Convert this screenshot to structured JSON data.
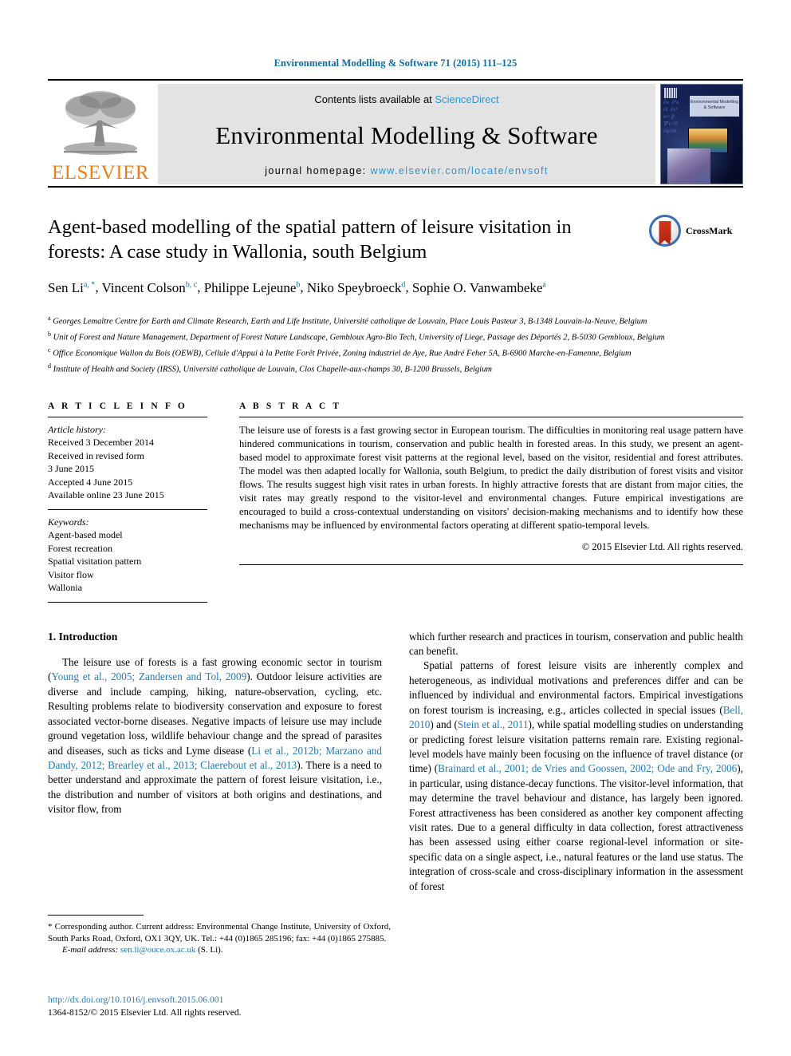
{
  "running_head": "Environmental Modelling & Software 71 (2015) 111–125",
  "masthead": {
    "publisher_logo_text": "ELSEVIER",
    "contents_prefix": "Contents lists available at ",
    "contents_link": "ScienceDirect",
    "journal_title": "Environmental Modelling & Software",
    "homepage_prefix": "journal homepage: ",
    "homepage_url": "www.elsevier.com/locate/envsoft",
    "cover_title": "Environmental Modelling & Software"
  },
  "article": {
    "title": "Agent-based modelling of the spatial pattern of leisure visitation in forests: A case study in Wallonia, south Belgium",
    "authors_line_1": "Sen Li",
    "authors_html": "Sen Li a, *, Vincent Colson b, c, Philippe Lejeune b, Niko Speybroeck d, Sophie O. Vanwambeke a",
    "crossmark_label": "CrossMark"
  },
  "affiliations": [
    {
      "marker": "a",
      "text": "Georges Lemaître Centre for Earth and Climate Research, Earth and Life Institute, Université catholique de Louvain, Place Louis Pasteur 3, B-1348 Louvain-la-Neuve, Belgium"
    },
    {
      "marker": "b",
      "text": "Unit of Forest and Nature Management, Department of Forest Nature Landscape, Gembloux Agro-Bio Tech, University of Liege, Passage des Déportés 2, B-5030 Gembloux, Belgium"
    },
    {
      "marker": "c",
      "text": "Office Economique Wallon du Bois (OEWB), Cellule d'Appui à la Petite Forêt Privée, Zoning industriel de Aye, Rue André Feher 5A, B-6900 Marche-en-Famenne, Belgium"
    },
    {
      "marker": "d",
      "text": "Institute of Health and Society (IRSS), Université catholique de Louvain, Clos Chapelle-aux-champs 30, B-1200 Brussels, Belgium"
    }
  ],
  "article_info": {
    "heading": "A R T I C L E   I N F O",
    "history_label": "Article history:",
    "history": [
      "Received 3 December 2014",
      "Received in revised form",
      "3 June 2015",
      "Accepted 4 June 2015",
      "Available online 23 June 2015"
    ],
    "keywords_label": "Keywords:",
    "keywords": [
      "Agent-based model",
      "Forest recreation",
      "Spatial visitation pattern",
      "Visitor flow",
      "Wallonia"
    ]
  },
  "abstract": {
    "heading": "A B S T R A C T",
    "text": "The leisure use of forests is a fast growing sector in European tourism. The difficulties in monitoring real usage pattern have hindered communications in tourism, conservation and public health in forested areas. In this study, we present an agent-based model to approximate forest visit patterns at the regional level, based on the visitor, residential and forest attributes. The model was then adapted locally for Wallonia, south Belgium, to predict the daily distribution of forest visits and visitor flows. The results suggest high visit rates in urban forests. In highly attractive forests that are distant from major cities, the visit rates may greatly respond to the visitor-level and environmental changes. Future empirical investigations are encouraged to build a cross-contextual understanding on visitors' decision-making mechanisms and to identify how these mechanisms may be influenced by environmental factors operating at different spatio-temporal levels.",
    "copyright": "© 2015 Elsevier Ltd. All rights reserved."
  },
  "introduction": {
    "heading": "1. Introduction",
    "left_paragraph_1_a": "The leisure use of forests is a fast growing economic sector in tourism (",
    "left_cite_1": "Young et al., 2005; Zandersen and Tol, 2009",
    "left_paragraph_1_b": "). Outdoor leisure activities are diverse and include camping, hiking, nature-observation, cycling, etc. Resulting problems relate to biodiversity conservation and exposure to forest associated vector-borne diseases. Negative impacts of leisure use may include ground vegetation loss, wildlife behaviour change and the spread of parasites and diseases, such as ticks and Lyme disease (",
    "left_cite_2": "Li et al., 2012b; Marzano and Dandy, 2012; Brearley et al., 2013; Claerebout et al., 2013",
    "left_paragraph_1_c": "). There is a need to better understand and approximate the pattern of forest leisure visitation, i.e., the distribution and number of visitors at both origins and destinations, and visitor flow, from",
    "right_paragraph_1": "which further research and practices in tourism, conservation and public health can benefit.",
    "right_paragraph_2_a": "Spatial patterns of forest leisure visits are inherently complex and heterogeneous, as individual motivations and preferences differ and can be influenced by individual and environmental factors. Empirical investigations on forest tourism is increasing, e.g., articles collected in special issues (",
    "right_cite_1": "Bell, 2010",
    "right_paragraph_2_b": ") and (",
    "right_cite_2": "Stein et al., 2011",
    "right_paragraph_2_c": "), while spatial modelling studies on understanding or predicting forest leisure visitation patterns remain rare. Existing regional-level models have mainly been focusing on the influence of travel distance (or time) (",
    "right_cite_3": "Brainard et al., 2001; de Vries and Goossen, 2002; Ode and Fry, 2006",
    "right_paragraph_2_d": "), in particular, using distance-decay functions. The visitor-level information, that may determine the travel behaviour and distance, has largely been ignored. Forest attractiveness has been considered as another key component affecting visit rates. Due to a general difficulty in data collection, forest attractiveness has been assessed using either coarse regional-level information or site-specific data on a single aspect, i.e., natural features or the land use status. The integration of cross-scale and cross-disciplinary information in the assessment of forest"
  },
  "footnote": {
    "corresponding": "* Corresponding author. Current address: Environmental Change Institute, University of Oxford, South Parks Road, Oxford, OX1 3QY, UK. Tel.: +44 (0)1865 285196; fax: +44 (0)1865 275885.",
    "email_label": "E-mail address: ",
    "email": "sen.li@ouce.ox.ac.uk",
    "email_suffix": " (S. Li)."
  },
  "footer": {
    "doi": "http://dx.doi.org/10.1016/j.envsoft.2015.06.001",
    "issn_line": "1364-8152/© 2015 Elsevier Ltd. All rights reserved."
  },
  "colors": {
    "link_blue": "#1f7bbf",
    "header_blue": "#0b6ca8",
    "elsevier_orange": "#f07f13",
    "banner_gray": "#e3e3e3"
  }
}
